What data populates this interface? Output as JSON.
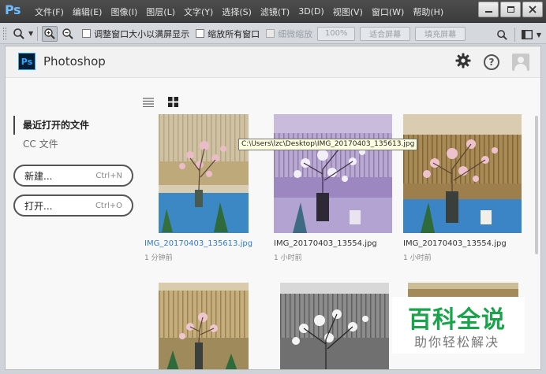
{
  "titlebar": {
    "logo": "Ps",
    "menu": [
      "文件(F)",
      "编辑(E)",
      "图像(I)",
      "图层(L)",
      "文字(Y)",
      "选择(S)",
      "滤镜(T)",
      "3D(D)",
      "视图(V)",
      "窗口(W)",
      "帮助(H)"
    ]
  },
  "options": {
    "resize_windows": "调整窗口大小以满屏显示",
    "zoom_all": "缩放所有窗口",
    "scrubby_zoom": "细微缩放",
    "zoom_100": "100%",
    "fit_screen": "适合屏幕",
    "fill_screen": "填充屏幕"
  },
  "start": {
    "app_badge": "Ps",
    "app_name": "Photoshop",
    "nav": {
      "recent": "最近打开的文件",
      "cc_files": "CC 文件"
    },
    "new_button": {
      "label": "新建...",
      "shortcut": "Ctrl+N"
    },
    "open_button": {
      "label": "打开...",
      "shortcut": "Ctrl+O"
    },
    "tooltip": "C:\\Users\\lzc\\Desktop\\IMG_20170403_135613.jpg",
    "files": [
      {
        "name": "IMG_20170403_135613.jpg",
        "time": "1 分钟前"
      },
      {
        "name": "IMG_20170403_13554.jpg",
        "time": "1 小时前"
      },
      {
        "name": "IMG_20170403_13554.jpg",
        "time": "1 小时前"
      }
    ]
  },
  "watermark": {
    "main": "百科全说",
    "sub": "助你轻松解决"
  },
  "colors": {
    "link": "#2f7bd1",
    "brand": "#31a8ff",
    "watermark": "#19a34a"
  }
}
